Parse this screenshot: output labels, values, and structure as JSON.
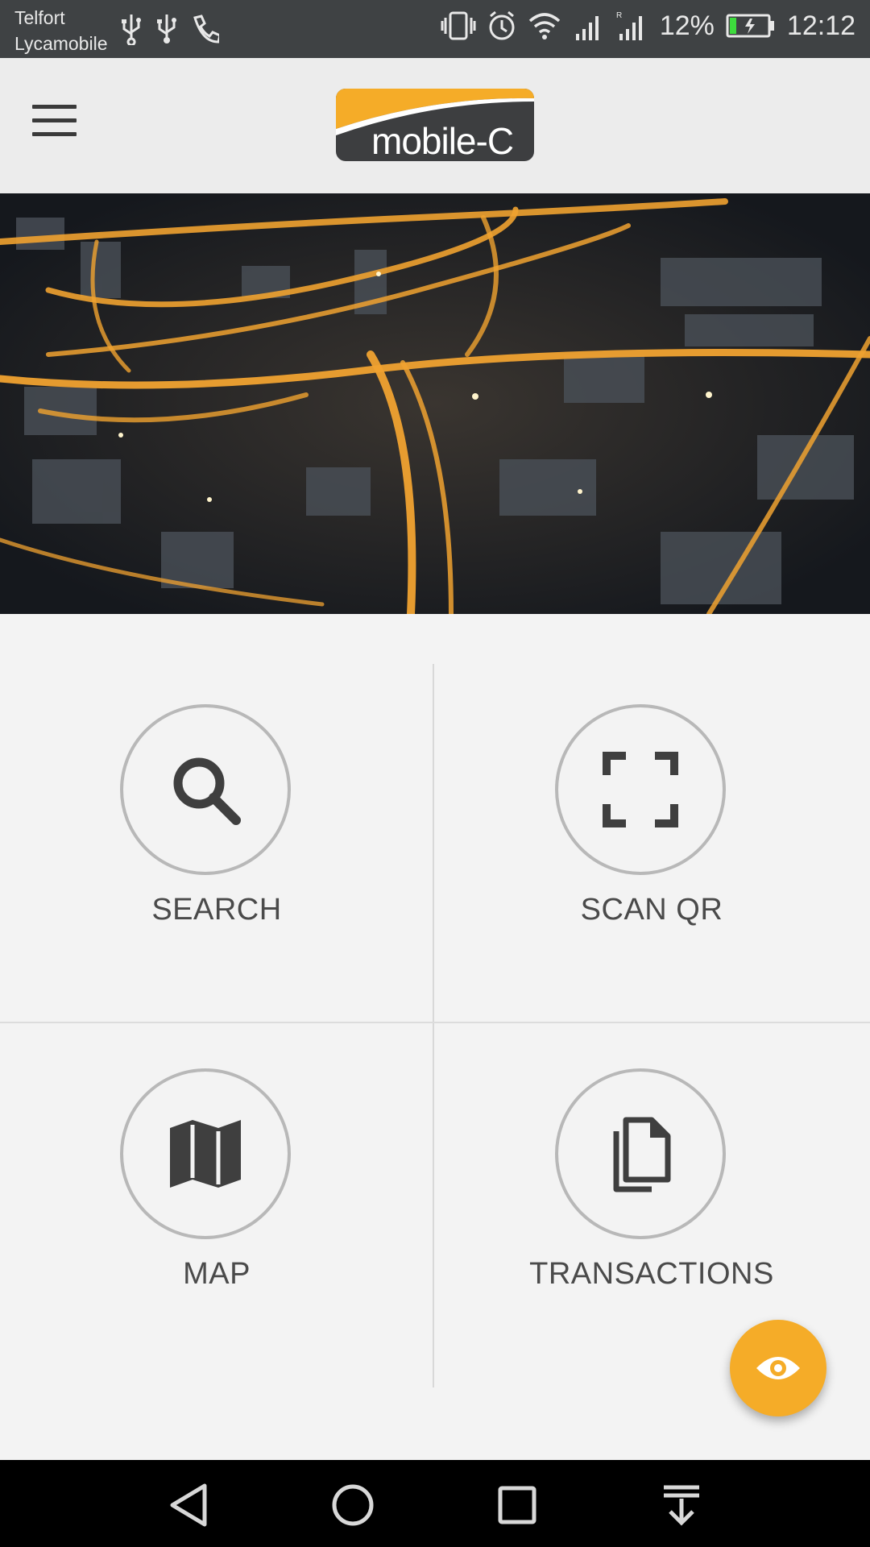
{
  "status_bar": {
    "carrier_1": "Telfort",
    "carrier_2": "Lycamobile",
    "battery_percent": "12%",
    "time": "12:12",
    "icons": [
      "usb-icon",
      "usb-icon",
      "call-icon",
      "vibrate-icon",
      "alarm-icon",
      "wifi-icon",
      "signal-icon",
      "signal-roaming-icon",
      "battery-charging-icon"
    ]
  },
  "app_bar": {
    "menu_icon": "hamburger-menu-icon",
    "logo_text": "mobile-C"
  },
  "hero": {
    "image": "night-city-highway-aerial"
  },
  "tiles": [
    {
      "label": "SEARCH",
      "icon": "search-icon"
    },
    {
      "label": "SCAN QR",
      "icon": "scan-qr-icon"
    },
    {
      "label": "MAP",
      "icon": "map-icon"
    },
    {
      "label": "TRANSACTIONS",
      "icon": "documents-icon"
    }
  ],
  "fab": {
    "icon": "eye-icon",
    "color": "#f5ac28"
  },
  "nav_bar": {
    "buttons": [
      "back-icon",
      "home-icon",
      "recents-icon",
      "notification-pull-icon"
    ]
  },
  "colors": {
    "accent": "#f5ac28",
    "status_bar": "#3f4244",
    "app_bar": "#ececec"
  }
}
